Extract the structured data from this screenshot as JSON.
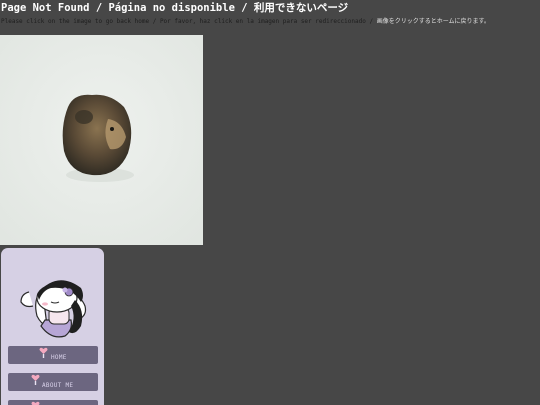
{
  "header": {
    "title": "Page Not Found / Página no disponible / 利用できないページ",
    "instructions_latin": "Please click on the image to go back home / Por favor, haz click en la imagen para ser redireccionado / ",
    "instructions_jp": "画像をクリックするとホームに戻ります。"
  },
  "sidebar": {
    "nav": [
      {
        "label": "HOME"
      },
      {
        "label": "ABOUT ME"
      },
      {
        "label": ""
      }
    ]
  },
  "colors": {
    "page_background": "#474747",
    "sidebar_background": "#d6d0e4",
    "nav_button": "#6c6680",
    "heart": "#f4a9c0"
  }
}
